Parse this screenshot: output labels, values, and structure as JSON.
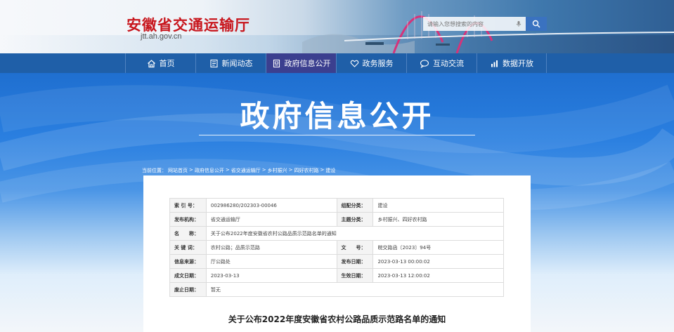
{
  "header": {
    "site_title": "安徽省交通运输厅",
    "site_url": "jtt.ah.gov.cn",
    "search_placeholder": "请输入您想搜索的内容"
  },
  "nav": {
    "items": [
      {
        "label": "首页",
        "icon": "home-icon"
      },
      {
        "label": "新闻动态",
        "icon": "news-icon"
      },
      {
        "label": "政府信息公开",
        "icon": "document-icon",
        "active": true
      },
      {
        "label": "政务服务",
        "icon": "heart-icon"
      },
      {
        "label": "互动交流",
        "icon": "chat-icon"
      },
      {
        "label": "数据开放",
        "icon": "data-icon"
      }
    ]
  },
  "banner": {
    "title": "政府信息公开"
  },
  "breadcrumb": {
    "prefix": "当前位置：",
    "items": [
      "网站首页",
      "政府信息公开",
      "省交通运输厅",
      "乡村振兴",
      "四好农村路",
      "建设"
    ],
    "separator": ">"
  },
  "meta": {
    "rows": [
      [
        {
          "k": "索 引 号：",
          "v": "002986280/202303-00046"
        },
        {
          "k": "组配分类：",
          "v": "建设"
        }
      ],
      [
        {
          "k": "发布机构：",
          "v": "省交通运输厅"
        },
        {
          "k": "主题分类：",
          "v": "乡村振兴、四好农村路"
        }
      ],
      [
        {
          "k": "名　　称：",
          "v": "关于公布2022年度安徽省农村公路品质示范路名单的通知",
          "span": true
        }
      ],
      [
        {
          "k": "关 键 词：",
          "v": "农村公路；品质示范路"
        },
        {
          "k": "文　　号：",
          "v": "皖交路函〔2023〕94号"
        }
      ],
      [
        {
          "k": "信息来源：",
          "v": "厅公路处"
        },
        {
          "k": "发布日期：",
          "v": "2023-03-13 00:00:02"
        }
      ],
      [
        {
          "k": "成文日期：",
          "v": "2023-03-13"
        },
        {
          "k": "生效日期：",
          "v": "2023-03-13 12:00:02"
        }
      ],
      [
        {
          "k": "废止日期：",
          "v": "暂无",
          "span": true
        }
      ]
    ]
  },
  "document": {
    "title": "关于公布2022年度安徽省农村公路品质示范路名单的通知"
  },
  "colors": {
    "brand_red": "#c8161d",
    "nav_blue": "#1f5fa8",
    "nav_active": "#3b3f8f",
    "search_button": "#3a72c0"
  }
}
